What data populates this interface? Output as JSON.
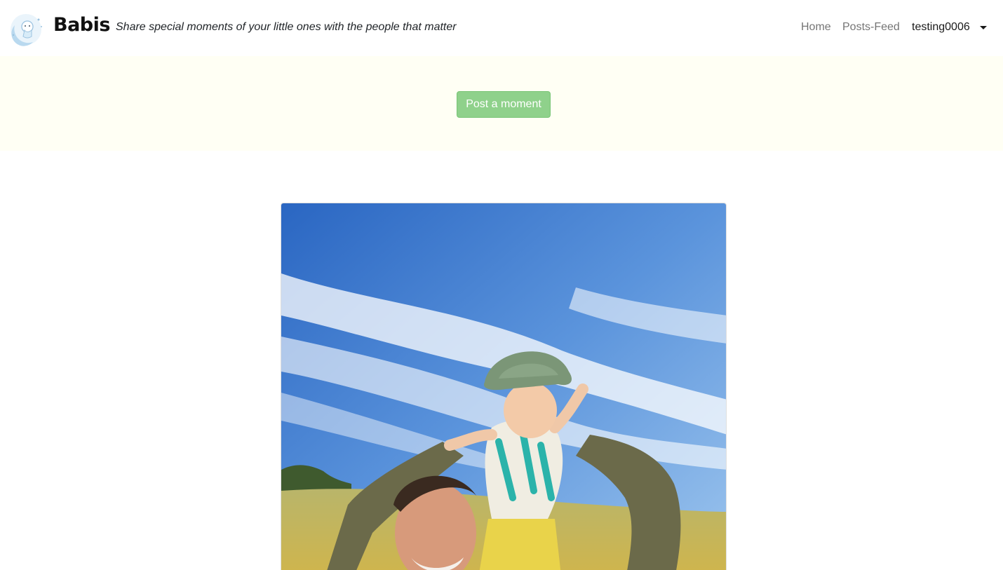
{
  "navbar": {
    "brand_name": "Babis",
    "tagline": "Share special moments of your little ones with the people that matter",
    "links": {
      "home": "Home",
      "posts_feed": "Posts-Feed"
    },
    "user": "testing0006"
  },
  "hero": {
    "post_button": "Post a moment"
  },
  "post": {
    "image_icon": "photo-dad-baby-shoulders-sky"
  },
  "colors": {
    "hero_bg": "#fffff4",
    "button_green": "#8fd18b"
  }
}
